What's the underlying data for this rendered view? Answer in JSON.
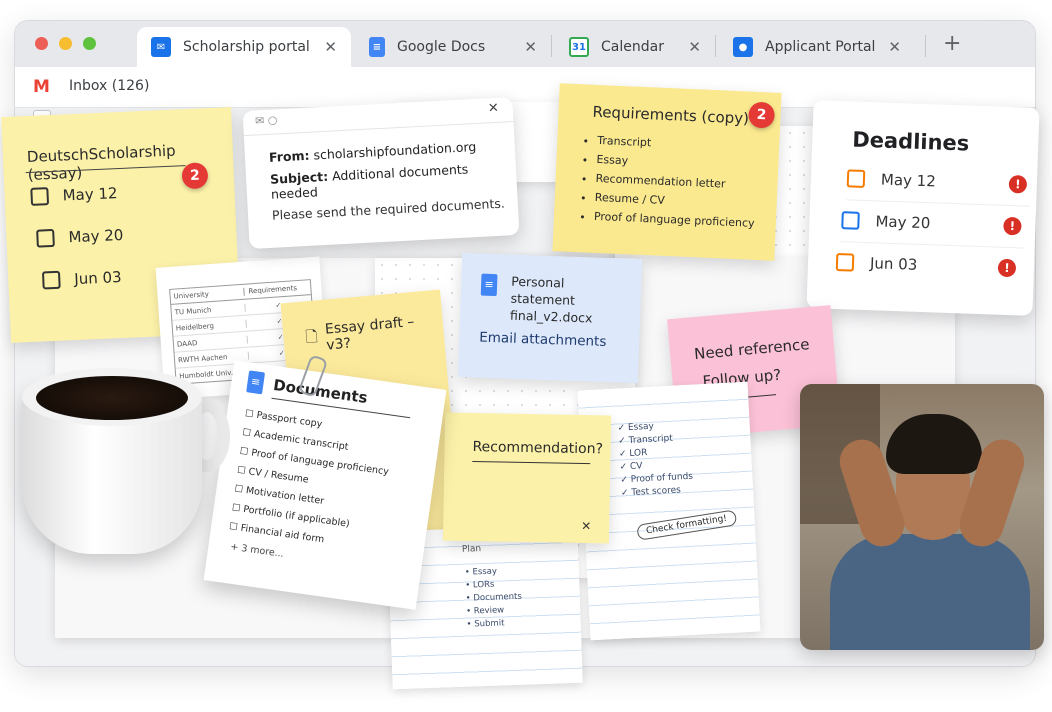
{
  "tabs": [
    {
      "label": "Scholarship portal",
      "icon": "gmail-icon"
    },
    {
      "label": "Google Docs",
      "icon": "docs-icon"
    },
    {
      "label": "Calendar",
      "icon": "calendar-icon",
      "icon_text": "31"
    },
    {
      "label": "Applicant Portal",
      "icon": "person-icon"
    }
  ],
  "new_tab_glyph": "+",
  "close_glyph": "✕",
  "address": {
    "inbox_label": "Inbox (126)"
  },
  "essay_note": {
    "title": "DeutschScholarship (essay)",
    "badge": "2",
    "dates": [
      "May 12",
      "May 20",
      "Jun 03"
    ]
  },
  "email_popup": {
    "from_label": "From:",
    "from": "scholarshipfoundation.org",
    "subject_label": "Subject:",
    "subject": "Additional documents needed",
    "body": "Please send the required documents."
  },
  "requirements_note": {
    "title": "Requirements (copy)",
    "badge": "2",
    "items": [
      "Transcript",
      "Essay",
      "Recommendation letter",
      "Resume / CV",
      "Proof of language proficiency"
    ]
  },
  "deadlines_card": {
    "title": "Deadlines",
    "items": [
      {
        "date": "May 12",
        "color": "#f57c00"
      },
      {
        "date": "May 20",
        "color": "#1a73e8"
      },
      {
        "date": "Jun 03",
        "color": "#f57c00"
      }
    ]
  },
  "university_table": {
    "headers": [
      "University",
      "Requirements"
    ],
    "rows": [
      "TU Munich",
      "Heidelberg",
      "DAAD",
      "RWTH Aachen",
      "Humboldt Univ."
    ]
  },
  "essay_draft_note": {
    "label": "Essay draft – v3?"
  },
  "personal_statement_note": {
    "file": "Personal statement final_v2.docx",
    "link": "Email attachments"
  },
  "reference_note": {
    "line1": "Need reference",
    "line2": "Follow up?"
  },
  "documents_card": {
    "title": "Documents",
    "items": [
      "Passport copy",
      "Academic transcript",
      "Proof of language proficiency",
      "CV / Resume",
      "Motivation letter",
      "Portfolio (if applicable)",
      "Financial aid form"
    ],
    "more": "+ 3 more..."
  },
  "recommendation_note": {
    "label": "Recommendation?"
  },
  "checklist_paper": {
    "items": [
      "Essay",
      "Transcript",
      "LOR",
      "CV",
      "Proof of funds",
      "Test scores"
    ],
    "stamp": "Check formatting!"
  },
  "plan_paper": {
    "title": "Plan",
    "items": [
      "Essay",
      "LORs",
      "Documents",
      "Review",
      "Submit"
    ]
  },
  "colors": {
    "yellow_note": "#fbf1a9",
    "pale_yellow_note": "#fdf3b8",
    "blue_note": "#dde9fb",
    "pink_note": "#fbc1d6",
    "alert_red": "#d93025",
    "badge_red": "#e53935"
  }
}
